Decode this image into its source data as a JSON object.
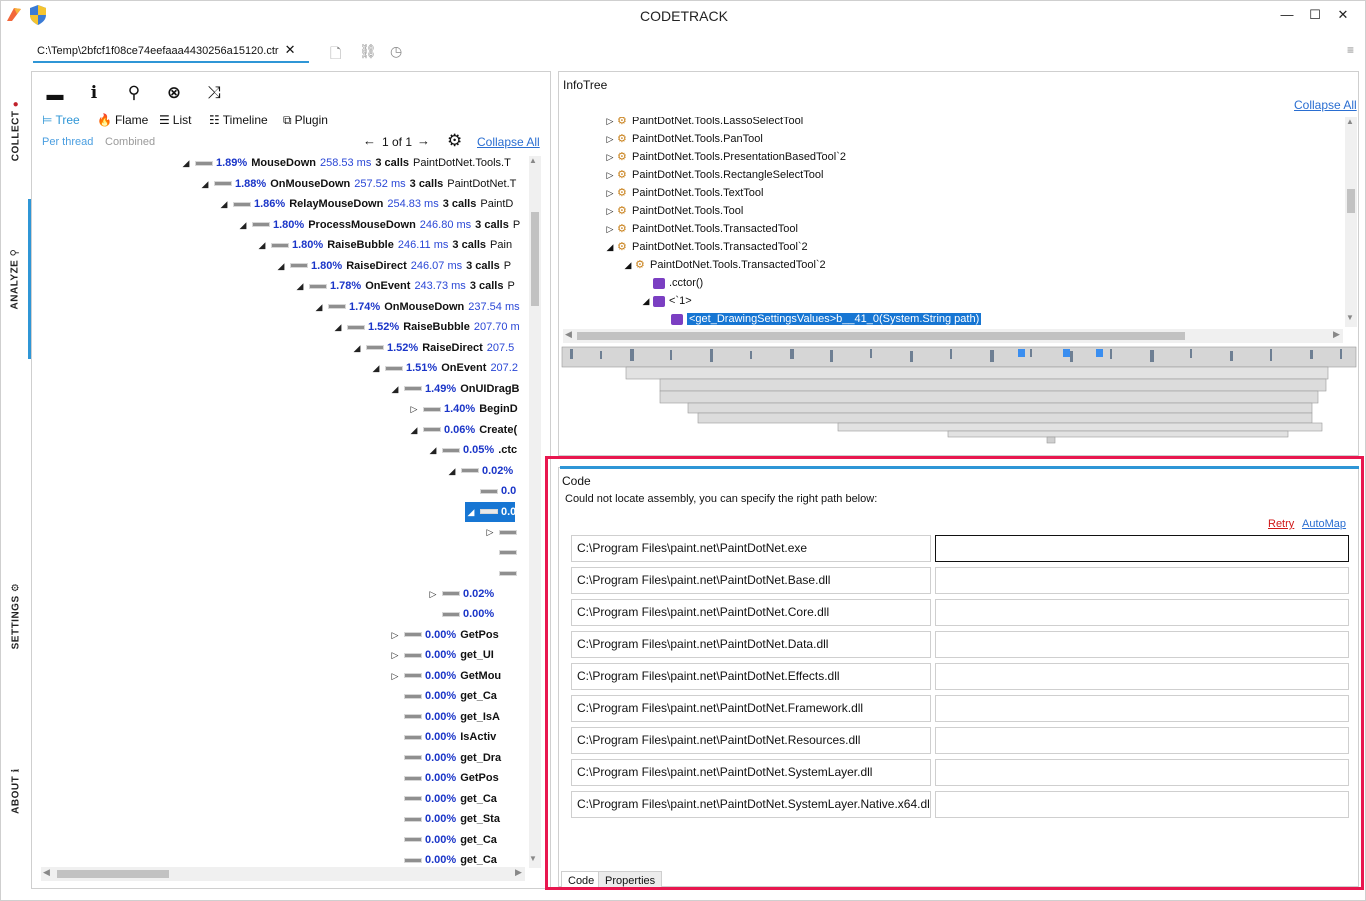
{
  "app": {
    "title": "CODETRACK"
  },
  "sidetabs": {
    "collect": "COLLECT",
    "analyze": "ANALYZE",
    "settings": "SETTINGS",
    "about": "ABOUT"
  },
  "file_tab": {
    "path": "C:\\Temp\\2bfcf1f08ce74eefaaa4430256a15120.ctr",
    "close": "✕"
  },
  "toolbar": {
    "views": {
      "tree": "Tree",
      "flame": "Flame",
      "list": "List",
      "timeline": "Timeline",
      "plugin": "Plugin"
    },
    "per_thread": "Per thread",
    "combined": "Combined",
    "pager": "1 of 1",
    "collapse_all": "Collapse All"
  },
  "calltree": [
    {
      "indent": 0,
      "arrow": "◢",
      "pct": "1.89%",
      "name": "MouseDown",
      "ms": "258.53 ms",
      "calls": "3 calls",
      "extra": "PaintDotNet.Tools.T"
    },
    {
      "indent": 1,
      "arrow": "◢",
      "pct": "1.88%",
      "name": "OnMouseDown",
      "ms": "257.52 ms",
      "calls": "3 calls",
      "extra": "PaintDotNet.T"
    },
    {
      "indent": 2,
      "arrow": "◢",
      "pct": "1.86%",
      "name": "RelayMouseDown",
      "ms": "254.83 ms",
      "calls": "3 calls",
      "extra": "PaintD"
    },
    {
      "indent": 3,
      "arrow": "◢",
      "pct": "1.80%",
      "name": "ProcessMouseDown",
      "ms": "246.80 ms",
      "calls": "3 calls",
      "extra": "P"
    },
    {
      "indent": 4,
      "arrow": "◢",
      "pct": "1.80%",
      "name": "RaiseBubble",
      "ms": "246.11 ms",
      "calls": "3 calls",
      "extra": "Pain"
    },
    {
      "indent": 5,
      "arrow": "◢",
      "pct": "1.80%",
      "name": "RaiseDirect",
      "ms": "246.07 ms",
      "calls": "3 calls",
      "extra": "P"
    },
    {
      "indent": 6,
      "arrow": "◢",
      "pct": "1.78%",
      "name": "OnEvent",
      "ms": "243.73 ms",
      "calls": "3 calls",
      "extra": "P"
    },
    {
      "indent": 7,
      "arrow": "◢",
      "pct": "1.74%",
      "name": "OnMouseDown",
      "ms": "237.54 ms",
      "calls": "",
      "extra": ""
    },
    {
      "indent": 8,
      "arrow": "◢",
      "pct": "1.52%",
      "name": "RaiseBubble",
      "ms": "207.70 m",
      "calls": "",
      "extra": ""
    },
    {
      "indent": 9,
      "arrow": "◢",
      "pct": "1.52%",
      "name": "RaiseDirect",
      "ms": "207.5",
      "calls": "",
      "extra": ""
    },
    {
      "indent": 10,
      "arrow": "◢",
      "pct": "1.51%",
      "name": "OnEvent",
      "ms": "207.2",
      "calls": "",
      "extra": ""
    },
    {
      "indent": 11,
      "arrow": "◢",
      "pct": "1.49%",
      "name": "OnUIDragB",
      "ms": "",
      "calls": "",
      "extra": ""
    },
    {
      "indent": 12,
      "arrow": "▷",
      "pct": "1.40%",
      "name": "BeginD",
      "ms": "",
      "calls": "",
      "extra": ""
    },
    {
      "indent": 12,
      "arrow": "◢",
      "pct": "0.06%",
      "name": "Create(",
      "ms": "",
      "calls": "",
      "extra": ""
    },
    {
      "indent": 13,
      "arrow": "◢",
      "pct": "0.05%",
      "name": ".ctc",
      "ms": "",
      "calls": "",
      "extra": ""
    },
    {
      "indent": 14,
      "arrow": "◢",
      "pct": "0.02%",
      "name": "",
      "ms": "",
      "calls": "",
      "extra": ""
    },
    {
      "indent": 15,
      "arrow": "",
      "pct": "0.0",
      "name": "",
      "ms": "",
      "calls": "",
      "extra": ""
    },
    {
      "indent": 15,
      "arrow": "◢",
      "pct": "0.0",
      "name": "",
      "ms": "",
      "calls": "",
      "extra": "",
      "selected": true
    },
    {
      "indent": 16,
      "arrow": "▷",
      "pct": "",
      "name": "",
      "ms": "",
      "calls": "",
      "extra": ""
    },
    {
      "indent": 16,
      "arrow": "",
      "pct": "",
      "name": "",
      "ms": "",
      "calls": "",
      "extra": ""
    },
    {
      "indent": 16,
      "arrow": "",
      "pct": "",
      "name": "",
      "ms": "",
      "calls": "",
      "extra": ""
    },
    {
      "indent": 13,
      "arrow": "▷",
      "pct": "0.02%",
      "name": "",
      "ms": "",
      "calls": "",
      "extra": ""
    },
    {
      "indent": 13,
      "arrow": "",
      "pct": "0.00%",
      "name": "",
      "ms": "",
      "calls": "",
      "extra": ""
    },
    {
      "indent": 11,
      "arrow": "▷",
      "pct": "0.00%",
      "name": "GetPos",
      "ms": "",
      "calls": "",
      "extra": ""
    },
    {
      "indent": 11,
      "arrow": "▷",
      "pct": "0.00%",
      "name": "get_UI",
      "ms": "",
      "calls": "",
      "extra": ""
    },
    {
      "indent": 11,
      "arrow": "▷",
      "pct": "0.00%",
      "name": "GetMou",
      "ms": "",
      "calls": "",
      "extra": ""
    },
    {
      "indent": 11,
      "arrow": "",
      "pct": "0.00%",
      "name": "get_Ca",
      "ms": "",
      "calls": "",
      "extra": ""
    },
    {
      "indent": 11,
      "arrow": "",
      "pct": "0.00%",
      "name": "get_IsA",
      "ms": "",
      "calls": "",
      "extra": ""
    },
    {
      "indent": 11,
      "arrow": "",
      "pct": "0.00%",
      "name": "IsActiv",
      "ms": "",
      "calls": "",
      "extra": ""
    },
    {
      "indent": 11,
      "arrow": "",
      "pct": "0.00%",
      "name": "get_Dra",
      "ms": "",
      "calls": "",
      "extra": ""
    },
    {
      "indent": 11,
      "arrow": "",
      "pct": "0.00%",
      "name": "GetPos",
      "ms": "",
      "calls": "",
      "extra": ""
    },
    {
      "indent": 11,
      "arrow": "",
      "pct": "0.00%",
      "name": "get_Ca",
      "ms": "",
      "calls": "",
      "extra": ""
    },
    {
      "indent": 11,
      "arrow": "",
      "pct": "0.00%",
      "name": "get_Sta",
      "ms": "",
      "calls": "",
      "extra": ""
    },
    {
      "indent": 11,
      "arrow": "",
      "pct": "0.00%",
      "name": "get_Ca",
      "ms": "",
      "calls": "",
      "extra": ""
    },
    {
      "indent": 11,
      "arrow": "",
      "pct": "0.00%",
      "name": "get_Ca",
      "ms": "",
      "calls": "",
      "extra": ""
    }
  ],
  "infotree": {
    "header": "InfoTree",
    "collapse_all": "Collapse All",
    "items": [
      {
        "level": 0,
        "arrow": "▷",
        "kind": "class",
        "label": "PaintDotNet.Tools.LassoSelectTool"
      },
      {
        "level": 0,
        "arrow": "▷",
        "kind": "class",
        "label": "PaintDotNet.Tools.PanTool"
      },
      {
        "level": 0,
        "arrow": "▷",
        "kind": "class",
        "label": "PaintDotNet.Tools.PresentationBasedTool`2"
      },
      {
        "level": 0,
        "arrow": "▷",
        "kind": "class",
        "label": "PaintDotNet.Tools.RectangleSelectTool"
      },
      {
        "level": 0,
        "arrow": "▷",
        "kind": "class",
        "label": "PaintDotNet.Tools.TextTool"
      },
      {
        "level": 0,
        "arrow": "▷",
        "kind": "class",
        "label": "PaintDotNet.Tools.Tool"
      },
      {
        "level": 0,
        "arrow": "▷",
        "kind": "class",
        "label": "PaintDotNet.Tools.TransactedTool"
      },
      {
        "level": 0,
        "arrow": "◢",
        "kind": "class",
        "label": "PaintDotNet.Tools.TransactedTool`2"
      },
      {
        "level": 1,
        "arrow": "◢",
        "kind": "class",
        "label": "PaintDotNet.Tools.TransactedTool`2"
      },
      {
        "level": 2,
        "arrow": "",
        "kind": "method",
        "label": ".cctor()"
      },
      {
        "level": 2,
        "arrow": "◢",
        "kind": "method",
        "label": "<`1>"
      },
      {
        "level": 3,
        "arrow": "",
        "kind": "method",
        "label": "<get_DrawingSettingsValues>b__41_0(System.String path)",
        "selected": true
      }
    ]
  },
  "code": {
    "header": "Code",
    "message": "Could not locate assembly, you can specify the right path below:",
    "retry": "Retry",
    "automap": "AutoMap",
    "rows": [
      {
        "path": "C:\\Program Files\\paint.net\\PaintDotNet.exe",
        "value": ""
      },
      {
        "path": "C:\\Program Files\\paint.net\\PaintDotNet.Base.dll",
        "value": ""
      },
      {
        "path": "C:\\Program Files\\paint.net\\PaintDotNet.Core.dll",
        "value": ""
      },
      {
        "path": "C:\\Program Files\\paint.net\\PaintDotNet.Data.dll",
        "value": ""
      },
      {
        "path": "C:\\Program Files\\paint.net\\PaintDotNet.Effects.dll",
        "value": ""
      },
      {
        "path": "C:\\Program Files\\paint.net\\PaintDotNet.Framework.dll",
        "value": ""
      },
      {
        "path": "C:\\Program Files\\paint.net\\PaintDotNet.Resources.dll",
        "value": ""
      },
      {
        "path": "C:\\Program Files\\paint.net\\PaintDotNet.SystemLayer.dll",
        "value": ""
      },
      {
        "path": "C:\\Program Files\\paint.net\\PaintDotNet.SystemLayer.Native.x64.dll",
        "value": ""
      }
    ],
    "tabs": {
      "code": "Code",
      "properties": "Properties"
    }
  },
  "colors": {
    "accent": "#2f96d6",
    "selection": "#1776d3",
    "percent": "#1a35c8",
    "highlight": "#e8174f",
    "retry": "#d01818"
  }
}
